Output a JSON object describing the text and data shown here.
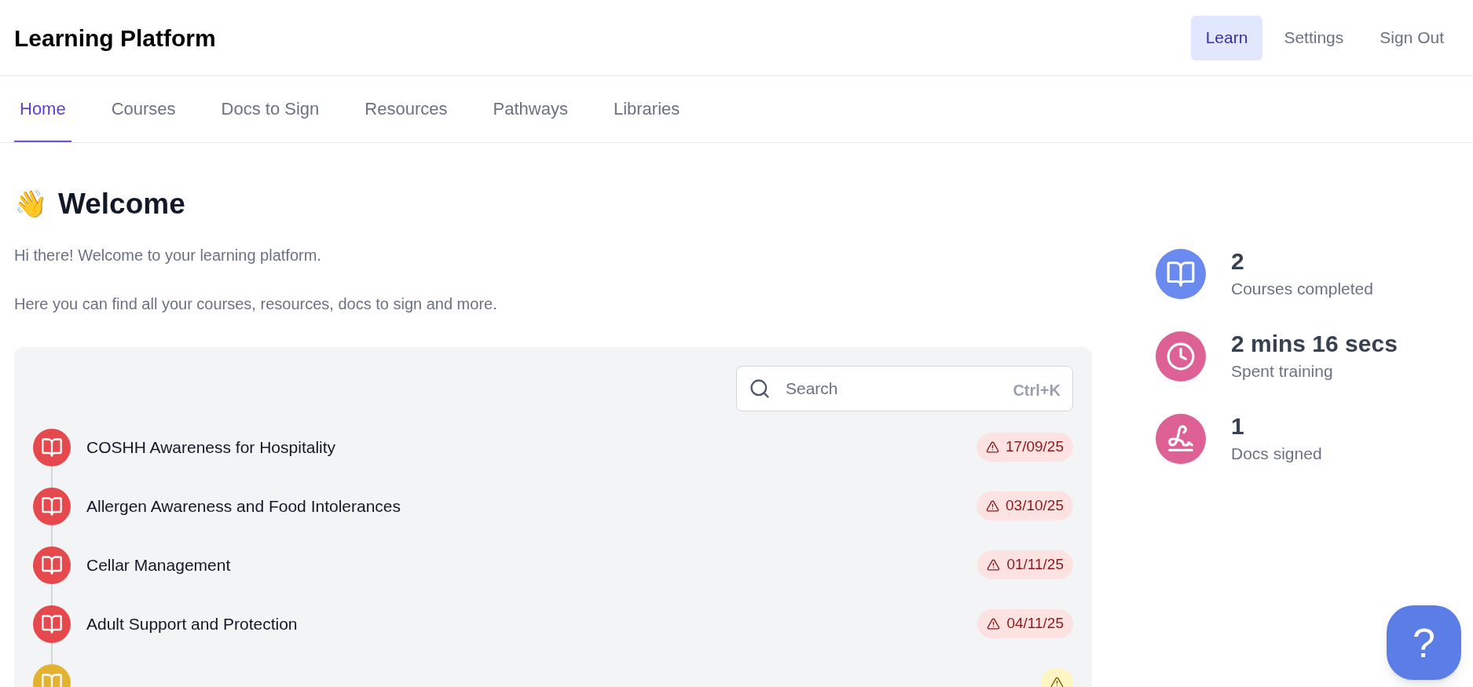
{
  "header": {
    "title": "Learning Platform",
    "actions": [
      {
        "label": "Learn",
        "selected": true
      },
      {
        "label": "Settings",
        "selected": false
      },
      {
        "label": "Sign Out",
        "selected": false
      }
    ]
  },
  "tabs": [
    {
      "label": "Home",
      "selected": true
    },
    {
      "label": "Courses",
      "selected": false
    },
    {
      "label": "Docs to Sign",
      "selected": false
    },
    {
      "label": "Resources",
      "selected": false
    },
    {
      "label": "Pathways",
      "selected": false
    },
    {
      "label": "Libraries",
      "selected": false
    }
  ],
  "welcome": {
    "emoji": "👋",
    "heading": "Welcome",
    "lines": [
      "Hi there! Welcome to your learning platform.",
      "Here you can find all your courses, resources, docs to sign and more."
    ]
  },
  "search": {
    "placeholder": "Search",
    "shortcut": "Ctrl+K"
  },
  "courses": [
    {
      "title": "COSHH Awareness for Hospitality",
      "due": "17/09/25",
      "kind": "overdue"
    },
    {
      "title": "Allergen Awareness and Food Intolerances",
      "due": "03/10/25",
      "kind": "overdue"
    },
    {
      "title": "Cellar Management",
      "due": "01/11/25",
      "kind": "overdue"
    },
    {
      "title": "Adult Support and Protection",
      "due": "04/11/25",
      "kind": "overdue"
    },
    {
      "kind": "upcoming"
    }
  ],
  "stats": [
    {
      "kind": "courses",
      "value": "2",
      "label": "Courses completed"
    },
    {
      "kind": "time",
      "value": "2 mins 16 secs",
      "label": "Spent training"
    },
    {
      "kind": "signed",
      "value": "1",
      "label": "Docs signed"
    }
  ],
  "help": {
    "glyph": "?"
  }
}
